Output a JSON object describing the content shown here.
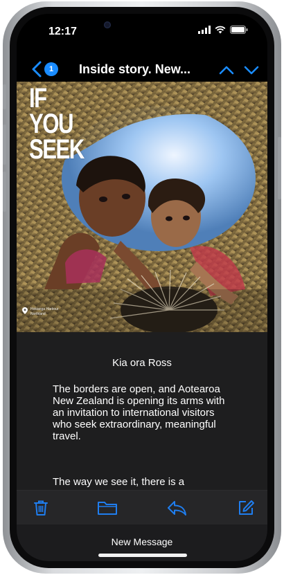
{
  "status_bar": {
    "time": "12:17"
  },
  "nav": {
    "unread_count": "1",
    "title": "Inside story. New..."
  },
  "hero": {
    "title_lines": [
      "IF",
      "YOU",
      "SEEK"
    ],
    "caption_line1": "Hokianga Harbour",
    "caption_line2": "Northland"
  },
  "email": {
    "greeting": "Kia ora Ross",
    "paragraph1": "The borders are open, and Aotearoa New Zealand is opening its arms with an invitation to international visitors who seek extraordinary, meaningful travel.",
    "paragraph2": "The way we see it, there is a"
  },
  "toolbar": {
    "new_message": "New Message"
  },
  "colors": {
    "accent": "#1a8cff",
    "background": "#1e1e1f",
    "toolbar_icon": "#1f7ef0"
  }
}
